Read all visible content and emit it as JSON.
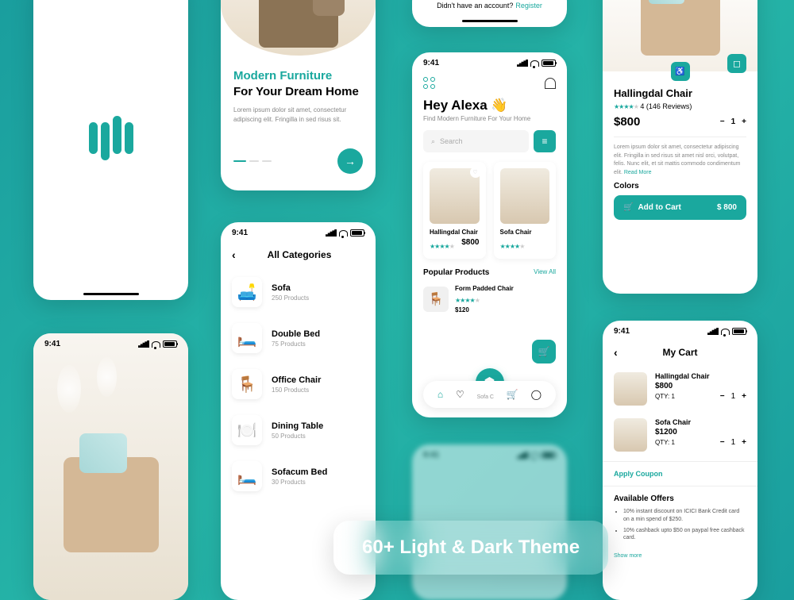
{
  "status_time": "9:41",
  "onboard": {
    "title_teal": "Modern Furniture",
    "title_black": "For Your Dream Home",
    "body": "Lorem ipsum dolor sit amet, consectetur adipiscing elit. Fringilla in sed risus sit."
  },
  "register": {
    "prompt": "Didn't have an account?",
    "link": "Register"
  },
  "categories": {
    "title": "All Categories",
    "items": [
      {
        "icon": "🛋️",
        "name": "Sofa",
        "count": "250 Products"
      },
      {
        "icon": "🛏️",
        "name": "Double Bed",
        "count": "75 Products"
      },
      {
        "icon": "🪑",
        "name": "Office Chair",
        "count": "150 Products"
      },
      {
        "icon": "🍽️",
        "name": "Dining Table",
        "count": "50 Products"
      },
      {
        "icon": "🛏️",
        "name": "Sofacum Bed",
        "count": "30 Products"
      }
    ]
  },
  "home": {
    "greeting": "Hey Alexa 👋",
    "sub": "Find Modern Furniture For Your Home",
    "search": "Search",
    "products": [
      {
        "name": "Hallingdal Chair",
        "price": "$800"
      },
      {
        "name": "Sofa Chair",
        "price": ""
      }
    ],
    "popular_title": "Popular Products",
    "view_all": "View All",
    "popular": [
      {
        "name": "Form Padded Chair",
        "price": "$120"
      }
    ],
    "popular_sub": "Sofa C"
  },
  "detail": {
    "name": "Hallingdal Chair",
    "rating": "4 (146 Reviews)",
    "price": "$800",
    "qty": "1",
    "desc": "Lorem ipsum dolor sit amet, consectetur adipiscing elit. Fringilla in sed risus sit amet nisl orci, volutpat, felis. Nunc elit, et sit mattis commodo condimentum elit.",
    "read_more": "Read More",
    "colors": "Colors",
    "add_cart": "Add to Cart",
    "cart_price": "$ 800"
  },
  "cart": {
    "title": "My Cart",
    "items": [
      {
        "name": "Hallingdal Chair",
        "price": "$800",
        "qty": "QTY: 1"
      },
      {
        "name": "Sofa Chair",
        "price": "$1200",
        "qty": "QTY: 1"
      }
    ],
    "coupon": "Apply Coupon",
    "offers_title": "Available Offers",
    "offers": [
      "10% instant discount on ICICI Bank Credit card on a min spend of $250.",
      "10% cashback upto $50 on paypal free cashback card."
    ],
    "show_more": "Show more"
  },
  "banner": "60+ Light & Dark Theme"
}
